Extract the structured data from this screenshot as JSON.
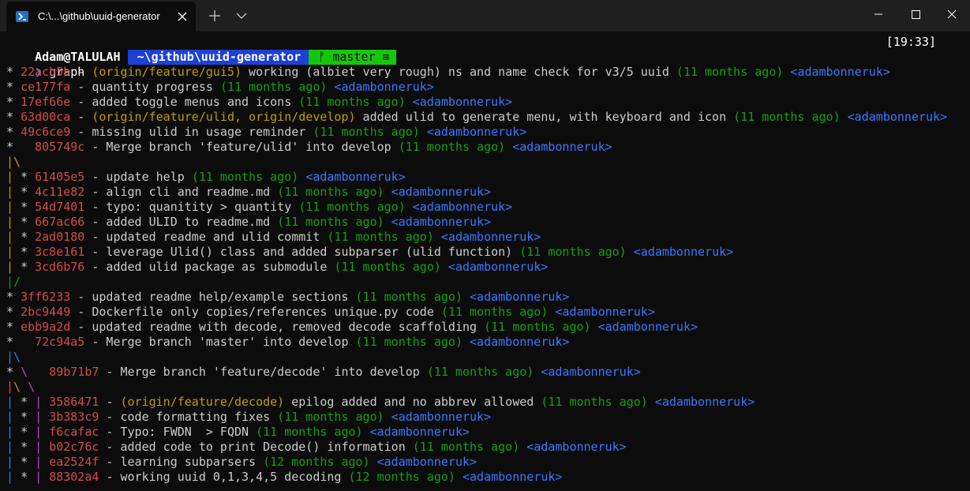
{
  "window": {
    "tab_title": "C:\\...\\github\\uuid-generator",
    "icons": [
      "powershell-icon",
      "close-icon",
      "plus-icon",
      "chevron-down-icon",
      "minimize-icon",
      "maximize-icon",
      "close-window-icon"
    ]
  },
  "prompt": {
    "user": "Adam@TALULAH",
    "path": "~\\github\\uuid-generator",
    "branch_glyph": "ᚠ",
    "branch": "master",
    "branch_status": "≡",
    "time": "[19:33]",
    "command": "graph"
  },
  "colors": {
    "background": "#0c0c0c",
    "hash": "#d44b4b",
    "ref": "#c19c00",
    "date": "#13a10e",
    "author": "#3b78ff",
    "path_segment": "#1e40d4",
    "git_segment": "#16c60c"
  },
  "log": [
    [
      {
        "t": "* ",
        "c": "c-graph"
      },
      {
        "t": "22acb5b",
        "c": "c-hash"
      },
      {
        "t": " - ",
        "c": "c-msg"
      },
      {
        "t": "(origin/feature/gui5)",
        "c": "c-ref"
      },
      {
        "t": " working (albiet very rough) ns and name check for v3/5 uuid ",
        "c": "c-msg"
      },
      {
        "t": "(11 months ago)",
        "c": "c-date"
      },
      {
        "t": " ",
        "c": "c-msg"
      },
      {
        "t": "<adambonneruk>",
        "c": "c-author"
      }
    ],
    [
      {
        "t": "* ",
        "c": "c-graph"
      },
      {
        "t": "ce177fa",
        "c": "c-hash"
      },
      {
        "t": " - quantity progress ",
        "c": "c-msg"
      },
      {
        "t": "(11 months ago)",
        "c": "c-date"
      },
      {
        "t": " ",
        "c": "c-msg"
      },
      {
        "t": "<adambonneruk>",
        "c": "c-author"
      }
    ],
    [
      {
        "t": "* ",
        "c": "c-graph"
      },
      {
        "t": "17ef66e",
        "c": "c-hash"
      },
      {
        "t": " - added toggle menus and icons ",
        "c": "c-msg"
      },
      {
        "t": "(11 months ago)",
        "c": "c-date"
      },
      {
        "t": " ",
        "c": "c-msg"
      },
      {
        "t": "<adambonneruk>",
        "c": "c-author"
      }
    ],
    [
      {
        "t": "* ",
        "c": "c-graph"
      },
      {
        "t": "63d00ca",
        "c": "c-hash"
      },
      {
        "t": " - ",
        "c": "c-msg"
      },
      {
        "t": "(origin/feature/ulid, origin/develop)",
        "c": "c-ref"
      },
      {
        "t": " added ulid to generate menu, with keyboard and icon ",
        "c": "c-msg"
      },
      {
        "t": "(11 months ago)",
        "c": "c-date"
      },
      {
        "t": " ",
        "c": "c-msg"
      },
      {
        "t": "<adambonneruk>",
        "c": "c-author"
      }
    ],
    [
      {
        "t": "* ",
        "c": "c-graph"
      },
      {
        "t": "49c6ce9",
        "c": "c-hash"
      },
      {
        "t": " - missing ulid in usage reminder ",
        "c": "c-msg"
      },
      {
        "t": "(11 months ago)",
        "c": "c-date"
      },
      {
        "t": " ",
        "c": "c-msg"
      },
      {
        "t": "<adambonneruk>",
        "c": "c-author"
      }
    ],
    [
      {
        "t": "*   ",
        "c": "c-graph"
      },
      {
        "t": "805749c",
        "c": "c-hash"
      },
      {
        "t": " - Merge branch 'feature/ulid' into develop ",
        "c": "c-msg"
      },
      {
        "t": "(11 months ago)",
        "c": "c-date"
      },
      {
        "t": " ",
        "c": "c-msg"
      },
      {
        "t": "<adambonneruk>",
        "c": "c-author"
      }
    ],
    [
      {
        "t": "|\\",
        "c": "g-yellow"
      }
    ],
    [
      {
        "t": "| ",
        "c": "g-yellow"
      },
      {
        "t": "* ",
        "c": "c-graph"
      },
      {
        "t": "61405e5",
        "c": "c-hash"
      },
      {
        "t": " - update help ",
        "c": "c-msg"
      },
      {
        "t": "(11 months ago)",
        "c": "c-date"
      },
      {
        "t": " ",
        "c": "c-msg"
      },
      {
        "t": "<adambonneruk>",
        "c": "c-author"
      }
    ],
    [
      {
        "t": "| ",
        "c": "g-yellow"
      },
      {
        "t": "* ",
        "c": "c-graph"
      },
      {
        "t": "4c11e82",
        "c": "c-hash"
      },
      {
        "t": " - align cli and readme.md ",
        "c": "c-msg"
      },
      {
        "t": "(11 months ago)",
        "c": "c-date"
      },
      {
        "t": " ",
        "c": "c-msg"
      },
      {
        "t": "<adambonneruk>",
        "c": "c-author"
      }
    ],
    [
      {
        "t": "| ",
        "c": "g-yellow"
      },
      {
        "t": "* ",
        "c": "c-graph"
      },
      {
        "t": "54d7401",
        "c": "c-hash"
      },
      {
        "t": " - typo: quanitity > quantity ",
        "c": "c-msg"
      },
      {
        "t": "(11 months ago)",
        "c": "c-date"
      },
      {
        "t": " ",
        "c": "c-msg"
      },
      {
        "t": "<adambonneruk>",
        "c": "c-author"
      }
    ],
    [
      {
        "t": "| ",
        "c": "g-yellow"
      },
      {
        "t": "* ",
        "c": "c-graph"
      },
      {
        "t": "667ac66",
        "c": "c-hash"
      },
      {
        "t": " - added ULID to readme.md ",
        "c": "c-msg"
      },
      {
        "t": "(11 months ago)",
        "c": "c-date"
      },
      {
        "t": " ",
        "c": "c-msg"
      },
      {
        "t": "<adambonneruk>",
        "c": "c-author"
      }
    ],
    [
      {
        "t": "| ",
        "c": "g-yellow"
      },
      {
        "t": "* ",
        "c": "c-graph"
      },
      {
        "t": "2ad0180",
        "c": "c-hash"
      },
      {
        "t": " - updated readme and ulid commit ",
        "c": "c-msg"
      },
      {
        "t": "(11 months ago)",
        "c": "c-date"
      },
      {
        "t": " ",
        "c": "c-msg"
      },
      {
        "t": "<adambonneruk>",
        "c": "c-author"
      }
    ],
    [
      {
        "t": "| ",
        "c": "g-yellow"
      },
      {
        "t": "* ",
        "c": "c-graph"
      },
      {
        "t": "3c8e161",
        "c": "c-hash"
      },
      {
        "t": " - leverage Ulid() class and added subparser (ulid function) ",
        "c": "c-msg"
      },
      {
        "t": "(11 months ago)",
        "c": "c-date"
      },
      {
        "t": " ",
        "c": "c-msg"
      },
      {
        "t": "<adambonneruk>",
        "c": "c-author"
      }
    ],
    [
      {
        "t": "| ",
        "c": "g-yellow"
      },
      {
        "t": "* ",
        "c": "c-graph"
      },
      {
        "t": "3cd6b76",
        "c": "c-hash"
      },
      {
        "t": " - added ulid package as submodule ",
        "c": "c-msg"
      },
      {
        "t": "(11 months ago)",
        "c": "c-date"
      },
      {
        "t": " ",
        "c": "c-msg"
      },
      {
        "t": "<adambonneruk>",
        "c": "c-author"
      }
    ],
    [
      {
        "t": "|/",
        "c": "g-green"
      }
    ],
    [
      {
        "t": "* ",
        "c": "c-graph"
      },
      {
        "t": "3ff6233",
        "c": "c-hash"
      },
      {
        "t": " - updated readme help/example sections ",
        "c": "c-msg"
      },
      {
        "t": "(11 months ago)",
        "c": "c-date"
      },
      {
        "t": " ",
        "c": "c-msg"
      },
      {
        "t": "<adambonneruk>",
        "c": "c-author"
      }
    ],
    [
      {
        "t": "* ",
        "c": "c-graph"
      },
      {
        "t": "2bc9449",
        "c": "c-hash"
      },
      {
        "t": " - Dockerfile only copies/references unique.py code ",
        "c": "c-msg"
      },
      {
        "t": "(11 months ago)",
        "c": "c-date"
      },
      {
        "t": " ",
        "c": "c-msg"
      },
      {
        "t": "<adambonneruk>",
        "c": "c-author"
      }
    ],
    [
      {
        "t": "* ",
        "c": "c-graph"
      },
      {
        "t": "ebb9a2d",
        "c": "c-hash"
      },
      {
        "t": " - updated readme with decode, removed decode scaffolding ",
        "c": "c-msg"
      },
      {
        "t": "(11 months ago)",
        "c": "c-date"
      },
      {
        "t": " ",
        "c": "c-msg"
      },
      {
        "t": "<adambonneruk>",
        "c": "c-author"
      }
    ],
    [
      {
        "t": "*   ",
        "c": "c-graph"
      },
      {
        "t": "72c94a5",
        "c": "c-hash"
      },
      {
        "t": " - Merge branch 'master' into develop ",
        "c": "c-msg"
      },
      {
        "t": "(11 months ago)",
        "c": "c-date"
      },
      {
        "t": " ",
        "c": "c-msg"
      },
      {
        "t": "<adambonneruk>",
        "c": "c-author"
      }
    ],
    [
      {
        "t": "|\\",
        "c": "g-blue"
      }
    ],
    [
      {
        "t": "* ",
        "c": "c-graph"
      },
      {
        "t": "\\   ",
        "c": "g-mag"
      },
      {
        "t": "89b71b7",
        "c": "c-hash"
      },
      {
        "t": " - Merge branch 'feature/decode' into develop ",
        "c": "c-msg"
      },
      {
        "t": "(11 months ago)",
        "c": "c-date"
      },
      {
        "t": " ",
        "c": "c-msg"
      },
      {
        "t": "<adambonneruk>",
        "c": "c-author"
      }
    ],
    [
      {
        "t": "|",
        "c": "g-red"
      },
      {
        "t": "\\ ",
        "c": "g-yellow"
      },
      {
        "t": "\\",
        "c": "g-mag"
      }
    ],
    [
      {
        "t": "| ",
        "c": "g-blue"
      },
      {
        "t": "* ",
        "c": "c-graph"
      },
      {
        "t": "| ",
        "c": "g-mag"
      },
      {
        "t": "3586471",
        "c": "c-hash"
      },
      {
        "t": " - ",
        "c": "c-msg"
      },
      {
        "t": "(origin/feature/decode)",
        "c": "c-ref"
      },
      {
        "t": " epilog added and no abbrev allowed ",
        "c": "c-msg"
      },
      {
        "t": "(11 months ago)",
        "c": "c-date"
      },
      {
        "t": " ",
        "c": "c-msg"
      },
      {
        "t": "<adambonneruk>",
        "c": "c-author"
      }
    ],
    [
      {
        "t": "| ",
        "c": "g-blue"
      },
      {
        "t": "* ",
        "c": "c-graph"
      },
      {
        "t": "| ",
        "c": "g-mag"
      },
      {
        "t": "3b383c9",
        "c": "c-hash"
      },
      {
        "t": " - code formatting fixes ",
        "c": "c-msg"
      },
      {
        "t": "(11 months ago)",
        "c": "c-date"
      },
      {
        "t": " ",
        "c": "c-msg"
      },
      {
        "t": "<adambonneruk>",
        "c": "c-author"
      }
    ],
    [
      {
        "t": "| ",
        "c": "g-blue"
      },
      {
        "t": "* ",
        "c": "c-graph"
      },
      {
        "t": "| ",
        "c": "g-mag"
      },
      {
        "t": "f6cafac",
        "c": "c-hash"
      },
      {
        "t": " - Typo: FWDN  > FQDN ",
        "c": "c-msg"
      },
      {
        "t": "(11 months ago)",
        "c": "c-date"
      },
      {
        "t": " ",
        "c": "c-msg"
      },
      {
        "t": "<adambonneruk>",
        "c": "c-author"
      }
    ],
    [
      {
        "t": "| ",
        "c": "g-blue"
      },
      {
        "t": "* ",
        "c": "c-graph"
      },
      {
        "t": "| ",
        "c": "g-mag"
      },
      {
        "t": "b02c76c",
        "c": "c-hash"
      },
      {
        "t": " - added code to print Decode() information ",
        "c": "c-msg"
      },
      {
        "t": "(11 months ago)",
        "c": "c-date"
      },
      {
        "t": " ",
        "c": "c-msg"
      },
      {
        "t": "<adambonneruk>",
        "c": "c-author"
      }
    ],
    [
      {
        "t": "| ",
        "c": "g-blue"
      },
      {
        "t": "* ",
        "c": "c-graph"
      },
      {
        "t": "| ",
        "c": "g-mag"
      },
      {
        "t": "ea2524f",
        "c": "c-hash"
      },
      {
        "t": " - learning subparsers ",
        "c": "c-msg"
      },
      {
        "t": "(12 months ago)",
        "c": "c-date"
      },
      {
        "t": " ",
        "c": "c-msg"
      },
      {
        "t": "<adambonneruk>",
        "c": "c-author"
      }
    ],
    [
      {
        "t": "| ",
        "c": "g-blue"
      },
      {
        "t": "* ",
        "c": "c-graph"
      },
      {
        "t": "| ",
        "c": "g-mag"
      },
      {
        "t": "88302a4",
        "c": "c-hash"
      },
      {
        "t": " - working uuid 0,1,3,4,5 decoding ",
        "c": "c-msg"
      },
      {
        "t": "(12 months ago)",
        "c": "c-date"
      },
      {
        "t": " ",
        "c": "c-msg"
      },
      {
        "t": "<adambonneruk>",
        "c": "c-author"
      }
    ]
  ]
}
